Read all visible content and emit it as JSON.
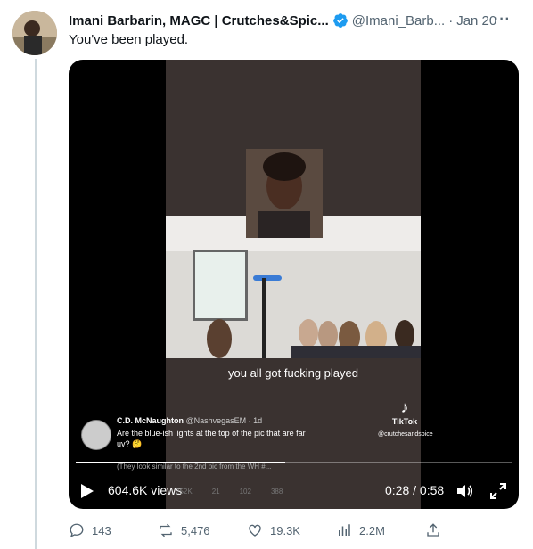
{
  "tweet": {
    "display_name": "Imani Barbarin, MAGC | Crutches&Spic...",
    "handle": "@Imani_Barb...",
    "time": "Jan 20",
    "text": "You've been played."
  },
  "video": {
    "caption": "you all got fucking played",
    "tiktok_label": "TikTok",
    "tiktok_handle": "@crutchesandspice",
    "embed": {
      "name": "C.D. McNaughton",
      "handle": "@NashvegasEM · 1d",
      "body": "Are the blue-ish lights at the top of the pic that are far uv? 🤔",
      "sub": "(They look similar to the 2nd pic from the WH #...",
      "stats": [
        "252K",
        "21",
        "102",
        "388"
      ]
    },
    "views": "604.6K views",
    "time_readout": "0:28 / 0:58",
    "progress": 0.48
  },
  "actions": {
    "replies": "143",
    "retweets": "5,476",
    "likes": "19.3K",
    "views": "2.2M"
  },
  "colors": {
    "verified": "#1d9bf0",
    "muted": "#536471"
  }
}
